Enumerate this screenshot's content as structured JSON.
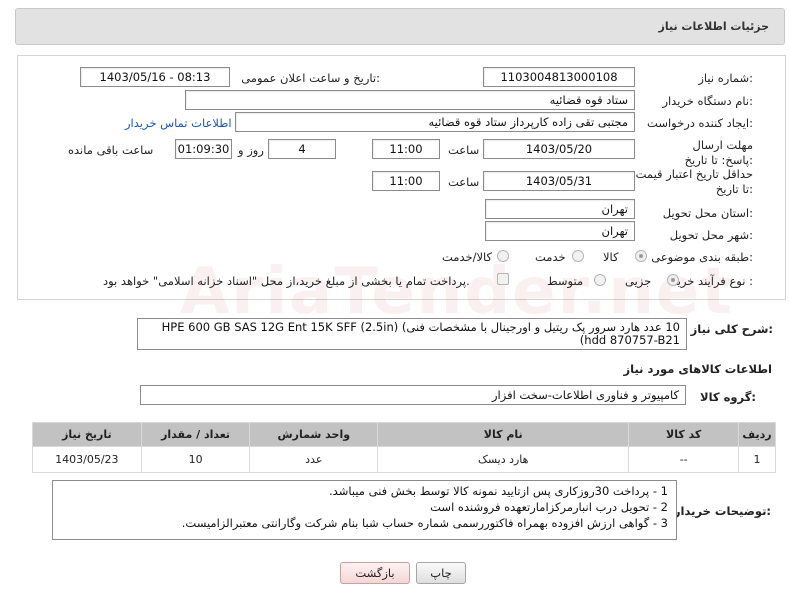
{
  "header": {
    "title": "جزئیات اطلاعات نیاز"
  },
  "form": {
    "need_number_label": "شماره نیاز:",
    "need_number": "1103004813000108",
    "announce_label": "تاریخ و ساعت اعلان عمومی:",
    "announce_value": "1403/05/16 - 08:13",
    "buyer_org_label": "نام دستگاه خریدار:",
    "buyer_org": "ستاد قوه قضائیه",
    "requester_label": "ایجاد کننده درخواست:",
    "requester": "مجتبی تقی زاده کارپرداز ستاد قوه قضائیه",
    "contact_link": "اطلاعات تماس خریدار",
    "deadline_label": "مهلت ارسال پاسخ: تا تاریخ:",
    "deadline_date": "1403/05/20",
    "time_label": "ساعت",
    "deadline_time": "11:00",
    "days_value": "4",
    "days_label": "روز و",
    "remaining_time": "01:09:30",
    "remaining_label": "ساعت باقی مانده",
    "validity_label": "حداقل تاریخ اعتبار قیمت: تا تاریخ:",
    "validity_date": "1403/05/31",
    "validity_time": "11:00",
    "province_label": "استان محل تحویل:",
    "province": "تهران",
    "city_label": "شهر محل تحویل:",
    "city": "تهران",
    "category_label": "طبقه بندی موضوعی:",
    "category_options": [
      "کالا",
      "خدمت",
      "کالا/خدمت"
    ],
    "process_label": "نوع فرآیند خرید :",
    "process_options": [
      "جزیی",
      "متوسط"
    ],
    "payment_note": "پرداخت تمام یا بخشی از مبلغ خرید،از محل \"اسناد خزانه اسلامی\" خواهد بود."
  },
  "description": {
    "label": "شرح کلی نیاز:",
    "text": "10 عدد هارد سرور پک ریتیل و اورجینال با مشخصات فنی)  HPE 600 GB SAS 12G Ent 15K SFF (2.5in) hdd 870757-B21)"
  },
  "goods": {
    "section_title": "اطلاعات کالاهای مورد نیاز",
    "group_label": "گروه کالا:",
    "group_value": "کامپیوتر و فناوری اطلاعات-سخت افزار",
    "columns": [
      "ردیف",
      "کد کالا",
      "نام کالا",
      "واحد شمارش",
      "تعداد / مقدار",
      "تاریخ نیاز"
    ],
    "rows": [
      [
        "1",
        "--",
        "هارد دیسک",
        "عدد",
        "10",
        "1403/05/23"
      ]
    ]
  },
  "buyer_notes": {
    "label": "توضیحات خریدار:",
    "lines": [
      "1 -  پرداخت 30روزکاری پس ازتایید نمونه کالا توسط بخش فنی میباشد.",
      "2 -  تحویل درب انبارمرکزامارتعهده فروشنده است",
      "3 - گواهی ارزش افزوده بهمراه فاکتوررسمی شماره حساب شبا بنام شرکت وگارانتی معتبرالزامیست."
    ]
  },
  "buttons": {
    "print": "چاپ",
    "back": "بازگشت"
  },
  "watermark": "AriaTender.net"
}
